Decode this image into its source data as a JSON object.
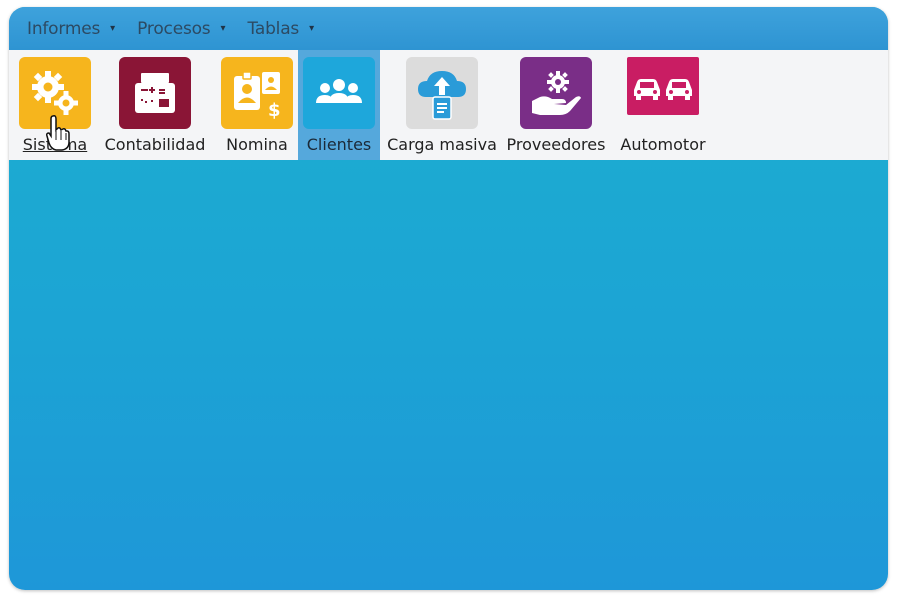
{
  "menu": {
    "items": [
      {
        "label": "Informes",
        "caret": "▾"
      },
      {
        "label": "Procesos",
        "caret": "▾"
      },
      {
        "label": "Tablas",
        "caret": "▾"
      }
    ]
  },
  "toolbar": {
    "items": [
      {
        "label": "Sistema",
        "icon": "gears-icon",
        "color": "#f6b51d"
      },
      {
        "label": "Contabilidad",
        "icon": "accounting-machine-icon",
        "color": "#8a1536"
      },
      {
        "label": "Nomina",
        "icon": "payroll-badge-icon",
        "color": "#f6b51d"
      },
      {
        "label": "Clientes",
        "icon": "users-group-icon",
        "color": "#1ea7db",
        "selected": true
      },
      {
        "label": "Carga masiva",
        "icon": "cloud-upload-icon",
        "color": "#dcdcdc"
      },
      {
        "label": "Proveedores",
        "icon": "hand-gear-icon",
        "color": "#7a2e87"
      },
      {
        "label": "Automotor",
        "icon": "cars-icon",
        "color": "#c91d63"
      }
    ]
  },
  "colors": {
    "menubar": "#2e94d2",
    "toolbar": "#f4f5f7",
    "content": "#1ca4d4",
    "selected": "#55a8dc"
  }
}
